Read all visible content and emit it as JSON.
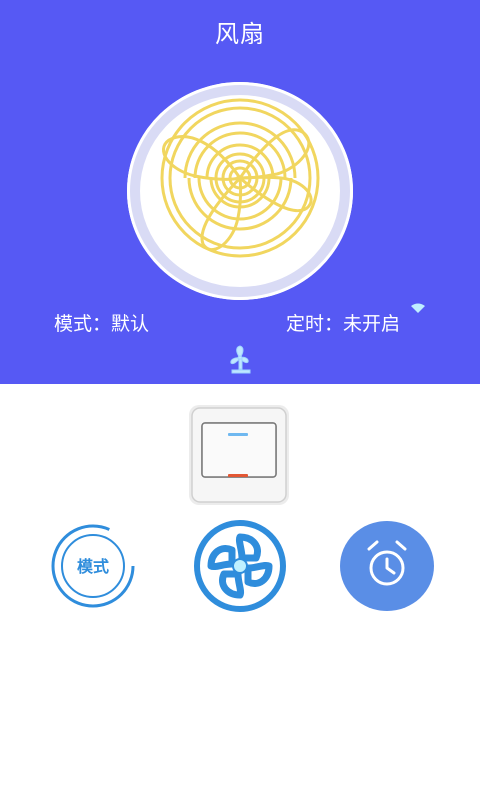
{
  "header": {
    "title": "风扇"
  },
  "status": {
    "mode_text": "模式：默认",
    "timer_text": "定时：未开启"
  },
  "controls": {
    "mode_button_label": "模式",
    "switch_icon": "power-switch-icon",
    "fan_icon": "fan-icon",
    "timer_icon": "alarm-clock-icon"
  },
  "colors": {
    "panel_background": "#5659f4",
    "fan_blade": "#f1d65f",
    "button_blue": "#2f8ddc",
    "timer_blue": "#5a8ee6",
    "switch_indicator_on": "#e35734",
    "switch_indicator_off": "#6fb8f0"
  }
}
